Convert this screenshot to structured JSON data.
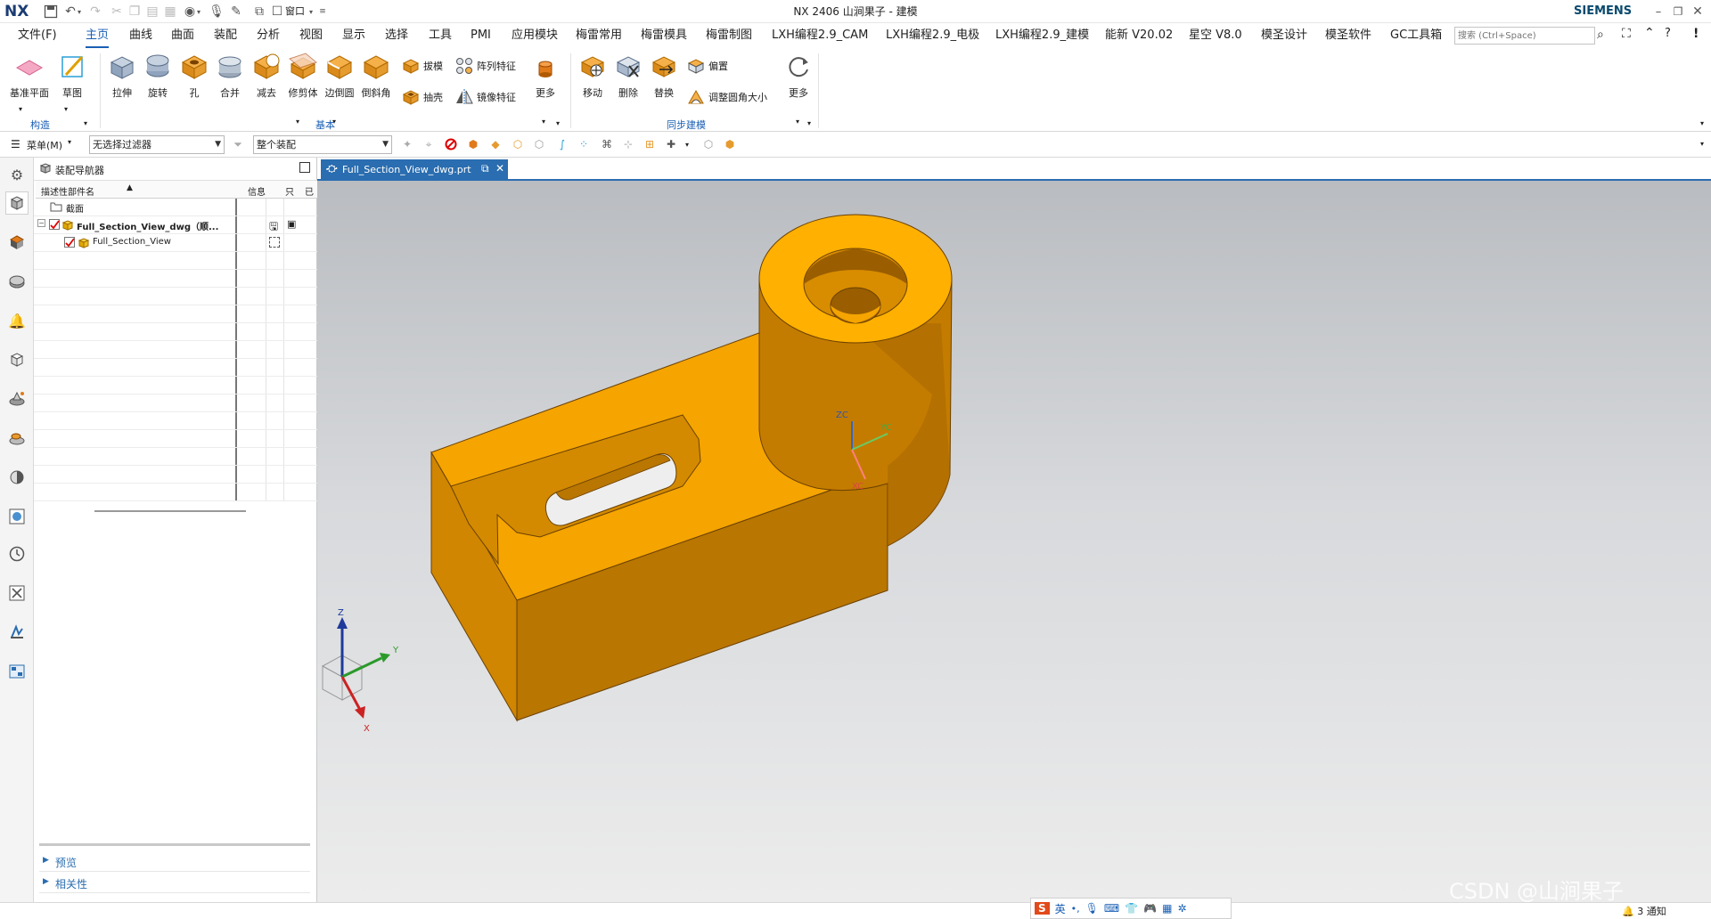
{
  "titlebar": {
    "logo": "NX",
    "title": "NX 2406 山涧果子 - 建模",
    "brand": "SIEMENS",
    "window_menu": "窗口"
  },
  "menubar": {
    "file": "文件(F)",
    "tabs": [
      "主页",
      "曲线",
      "曲面",
      "装配",
      "分析",
      "视图",
      "显示",
      "选择",
      "工具",
      "PMI",
      "应用模块",
      "梅雷常用",
      "梅雷模具",
      "梅雷制图",
      "LXH编程2.9_CAM",
      "LXH编程2.9_电极",
      "LXH编程2.9_建模",
      "能新 V20.02",
      "星空 V8.0",
      "模圣设计",
      "模圣软件",
      "GC工具箱"
    ],
    "active_tab": "主页",
    "search_placeholder": "搜索 (Ctrl+Space)"
  },
  "ribbon": {
    "construct": {
      "label": "构造",
      "datum_plane": "基准平面",
      "sketch": "草图"
    },
    "basic": {
      "label": "基本",
      "extrude": "拉伸",
      "revolve": "旋转",
      "hole": "孔",
      "unite": "合并",
      "subtract": "减去",
      "trim_body": "修剪体",
      "edge_blend": "边倒圆",
      "chamfer": "倒斜角",
      "draft": "拔模",
      "shell": "抽壳",
      "pattern_feature": "阵列特征",
      "mirror_feature": "镜像特征",
      "more": "更多"
    },
    "sync": {
      "label": "同步建模",
      "move": "移动",
      "delete": "删除",
      "replace": "替换",
      "offset": "偏置",
      "resize_blend": "调整圆角大小",
      "more": "更多"
    }
  },
  "toolbar2": {
    "menu": "菜单(M)",
    "filter": "无选择过滤器",
    "scope": "整个装配"
  },
  "navigator": {
    "title": "装配导航器",
    "col_name": "描述性部件名",
    "col_info": "信息",
    "col_readonly": "只",
    "col_last": "已",
    "rows": [
      {
        "label": "截面",
        "level": 0
      },
      {
        "label": "Full_Section_View_dwg（顺...",
        "level": 0
      },
      {
        "label": "Full_Section_View",
        "level": 1
      }
    ],
    "preview": "预览",
    "dependency": "相关性"
  },
  "document": {
    "tab": "Full_Section_View_dwg.prt"
  },
  "viewport": {
    "csys_z": "Z",
    "csys_y": "Y",
    "csys_x": "X",
    "wcs_z": "ZC",
    "wcs_y": "YC",
    "wcs_x": "XC",
    "part_color": "#F6A400",
    "part_top_color": "#FFB000",
    "part_side_color": "#C07800"
  },
  "statusbar": {
    "ime_lang": "英",
    "notifications": "3 通知",
    "watermark": "CSDN @山涧果子"
  }
}
